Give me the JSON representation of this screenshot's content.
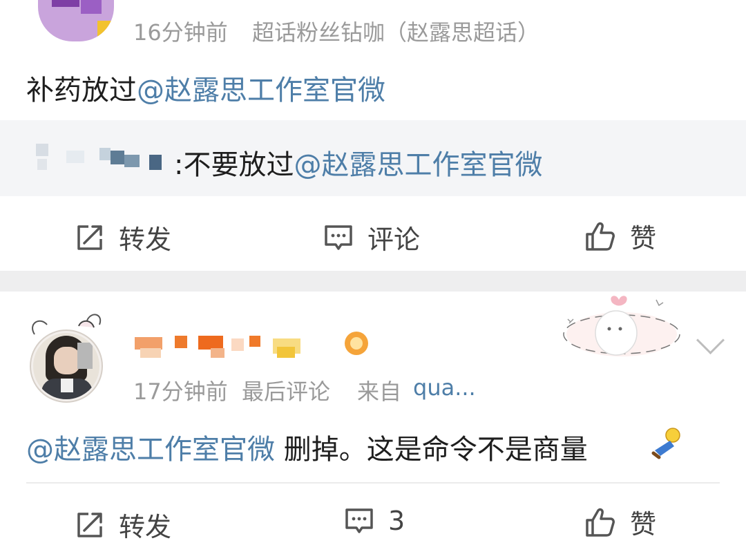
{
  "post1": {
    "time": "16分钟前",
    "source": "超话粉丝钻咖（赵露思超话）",
    "text_prefix": "补药放过",
    "mention": "@赵露思工作室官微",
    "reply": {
      "text_prefix": ":不要放过",
      "mention": "@赵露思工作室官微"
    },
    "actions": {
      "repost": "转发",
      "comment": "评论",
      "like": "赞"
    }
  },
  "post2": {
    "time": "17分钟前",
    "last_comment": "最后评论",
    "source_prefix": "来自",
    "source": "qua...",
    "mention": "@赵露思工作室官微",
    "text": " 删掉。这是命令不是商量",
    "actions": {
      "repost": "转发",
      "comment_count": "3",
      "like": "赞"
    }
  },
  "colors": {
    "mention": "#4e7ea8",
    "meta": "#9a9a9a",
    "quote_bg": "#f4f5f7",
    "band": "#eeeeef"
  },
  "icons": [
    "repost-icon",
    "comment-icon",
    "like-icon",
    "chevron-down-icon",
    "sticker-decoration",
    "emoji-kneel-icon"
  ]
}
